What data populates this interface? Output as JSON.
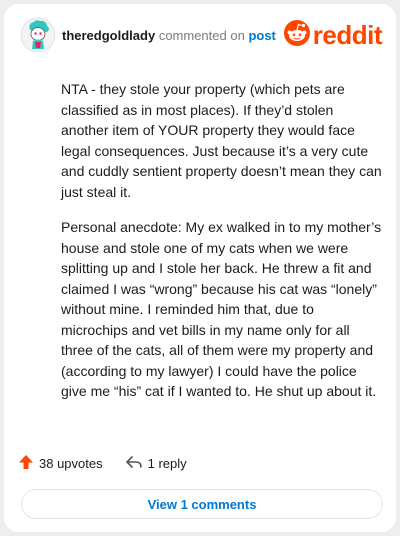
{
  "comment": {
    "username": "theredgoldlady",
    "action_text": "commented on",
    "post_link_text": "post",
    "paragraphs": [
      "NTA - they stole your property (which pets are classified as in most places). If they’d stolen another item of YOUR property they would face legal consequences. Just because it’s a very cute and cuddly sentient property doesn’t mean they can just steal it.",
      "Personal anecdote: My ex walked in to my mother’s house and stole one of my cats when we were splitting up and I stole her back. He threw a fit and claimed I was “wrong” because his cat was “lonely” without mine. I reminded him that, due to microchips and vet bills in my name only for all three of the cats, all of them were my property and (according to my lawyer) I could have the police give me “his” cat if I wanted to. He shut up about it."
    ]
  },
  "brand": {
    "name": "reddit",
    "color": "#ff4500",
    "icon": "reddit-snoo-icon"
  },
  "actions": {
    "upvotes_label": "38 upvotes",
    "upvote_icon": "upvote-arrow-icon",
    "upvote_color": "#ff4500",
    "reply_label": "1 reply",
    "reply_icon": "reply-arrow-icon"
  },
  "footer": {
    "view_comments_label": "View 1 comments"
  },
  "colors": {
    "link_blue": "#0079d3",
    "text": "#1c1c1c",
    "muted": "#787c7e"
  }
}
